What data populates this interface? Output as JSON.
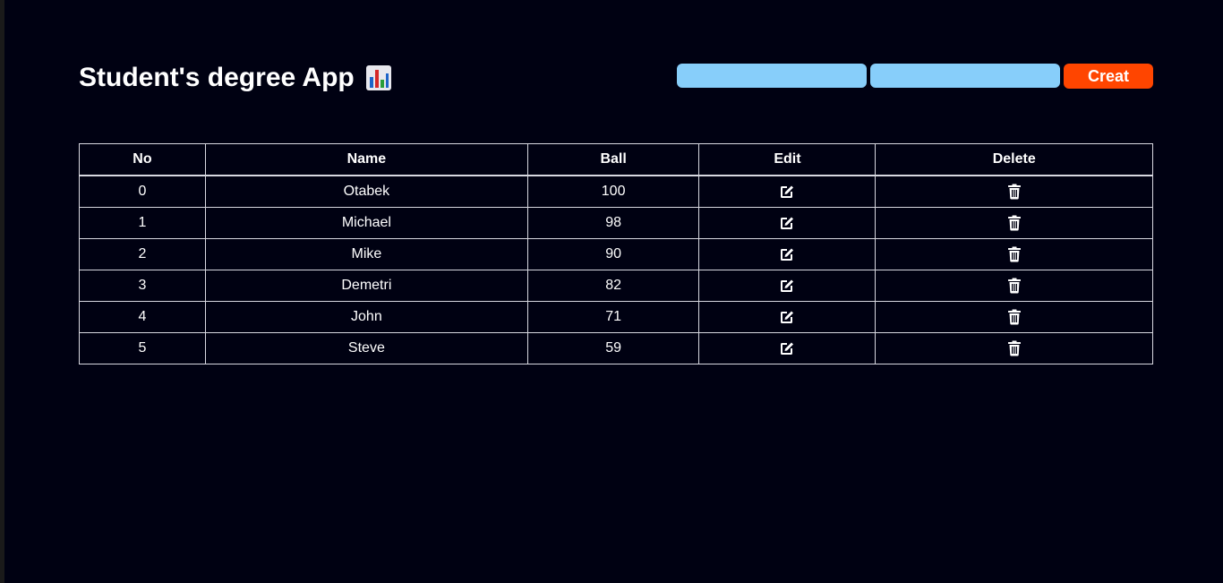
{
  "header": {
    "title": "Student's degree App",
    "title_icon": "bar-chart-icon"
  },
  "form": {
    "name_value": "",
    "ball_value": "",
    "create_label": "Creat"
  },
  "table": {
    "columns": [
      "No",
      "Name",
      "Ball",
      "Edit",
      "Delete"
    ],
    "rows": [
      {
        "no": "0",
        "name": "Otabek",
        "ball": "100"
      },
      {
        "no": "1",
        "name": "Michael",
        "ball": "98"
      },
      {
        "no": "2",
        "name": "Mike",
        "ball": "90"
      },
      {
        "no": "3",
        "name": "Demetri",
        "ball": "82"
      },
      {
        "no": "4",
        "name": "John",
        "ball": "71"
      },
      {
        "no": "5",
        "name": "Steve",
        "ball": "59"
      }
    ],
    "edit_icon": "edit-icon",
    "delete_icon": "trash-icon"
  },
  "colors": {
    "background": "#000112",
    "input_bg": "#87cefa",
    "button_bg": "#ff4500",
    "border": "#d8d8e0"
  }
}
